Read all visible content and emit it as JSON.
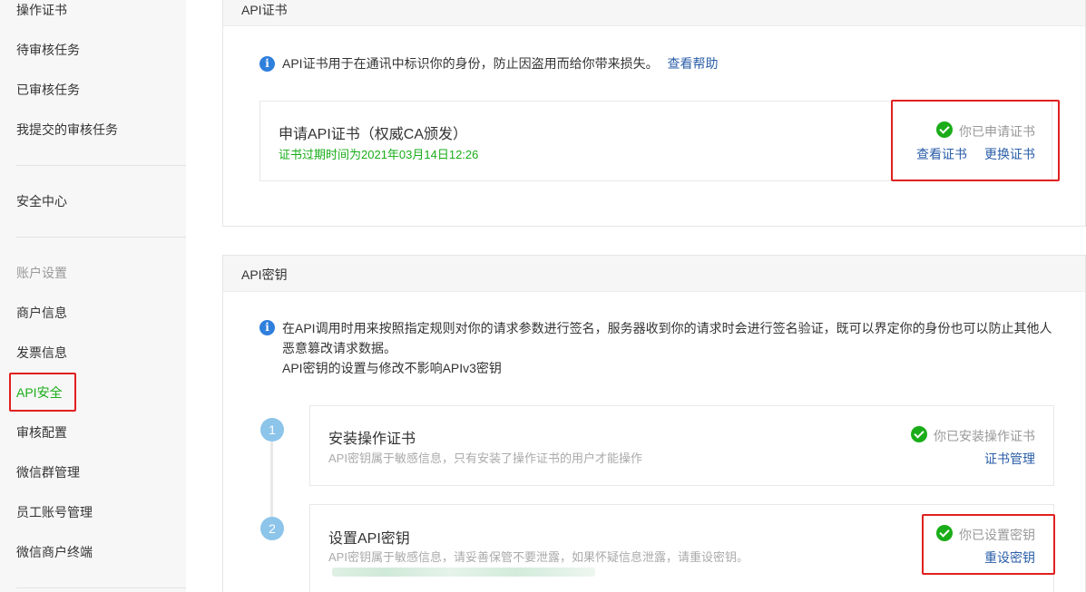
{
  "sidebar": {
    "items": [
      {
        "label": "操作证书"
      },
      {
        "label": "待审核任务"
      },
      {
        "label": "已审核任务"
      },
      {
        "label": "我提交的审核任务"
      },
      {
        "label": "安全中心"
      },
      {
        "label": "账户设置"
      },
      {
        "label": "商户信息"
      },
      {
        "label": "发票信息"
      },
      {
        "label": "API安全"
      },
      {
        "label": "审核配置"
      },
      {
        "label": "微信群管理"
      },
      {
        "label": "员工账号管理"
      },
      {
        "label": "微信商户终端"
      }
    ]
  },
  "cert_panel": {
    "title": "API证书",
    "notice": "API证书用于在通讯中标识你的身份，防止因盗用而给你带来损失。",
    "help_link": "查看帮助",
    "card": {
      "title": "申请API证书（权威CA颁发）",
      "expire": "证书过期时间为2021年03月14日12:26",
      "status": "你已申请证书",
      "view_link": "查看证书",
      "replace_link": "更换证书"
    }
  },
  "key_panel": {
    "title": "API密钥",
    "notice_line1": "在API调用时用来按照指定规则对你的请求参数进行签名，服务器收到你的请求时会进行签名验证，既可以界定你的身份也可以防止其他人",
    "notice_line2": "恶意篡改请求数据。",
    "notice_line3": "API密钥的设置与修改不影响APIv3密钥",
    "steps": [
      {
        "number": "1",
        "title": "安装操作证书",
        "desc": "API密钥属于敏感信息，只有安装了操作证书的用户才能操作",
        "status": "你已安装操作证书",
        "link": "证书管理"
      },
      {
        "number": "2",
        "title": "设置API密钥",
        "desc": "API密钥属于敏感信息，请妥善保管不要泄露，如果怀疑信息泄露，请重设密钥。",
        "status": "你已设置密钥",
        "link": "重设密钥"
      }
    ]
  },
  "colors": {
    "accent_green": "#1aad19",
    "link_blue": "#2a5ea8",
    "highlight_red": "#e02020",
    "info_blue": "#2f7fdc"
  }
}
